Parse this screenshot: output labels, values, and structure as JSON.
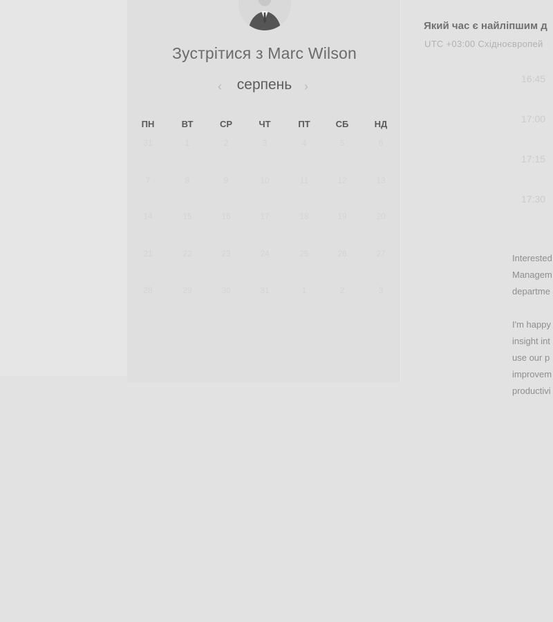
{
  "host": {
    "name": "Marc Wilson"
  },
  "title": "Зустрітися з Marc Wilson",
  "calendar": {
    "month": "серпень",
    "weekdays": [
      "ПН",
      "ВТ",
      "СР",
      "ЧТ",
      "ПТ",
      "СБ",
      "НД"
    ],
    "weeks": [
      [
        "31",
        "1",
        "2",
        "3",
        "4",
        "5",
        "6"
      ],
      [
        "7",
        "8",
        "9",
        "10",
        "11",
        "12",
        "13"
      ],
      [
        "14",
        "15",
        "16",
        "17",
        "18",
        "19",
        "20"
      ],
      [
        "21",
        "22",
        "23",
        "24",
        "25",
        "26",
        "27"
      ],
      [
        "28",
        "29",
        "30",
        "31",
        "1",
        "2",
        "3"
      ]
    ]
  },
  "time_panel": {
    "question": "Який час є найліпшим д",
    "timezone": "UTC +03:00 Східноєвропей",
    "slots": [
      "16:45",
      "17:00",
      "17:15",
      "17:30"
    ]
  },
  "bio": {
    "p1_lines": [
      "Interested",
      "Managem",
      "departme"
    ],
    "p2_lines": [
      "I'm happy",
      "insight int",
      "use our p",
      "improvem",
      "productivi"
    ]
  },
  "icons": {
    "prev": "chevron-left-icon",
    "next": "chevron-right-icon"
  }
}
